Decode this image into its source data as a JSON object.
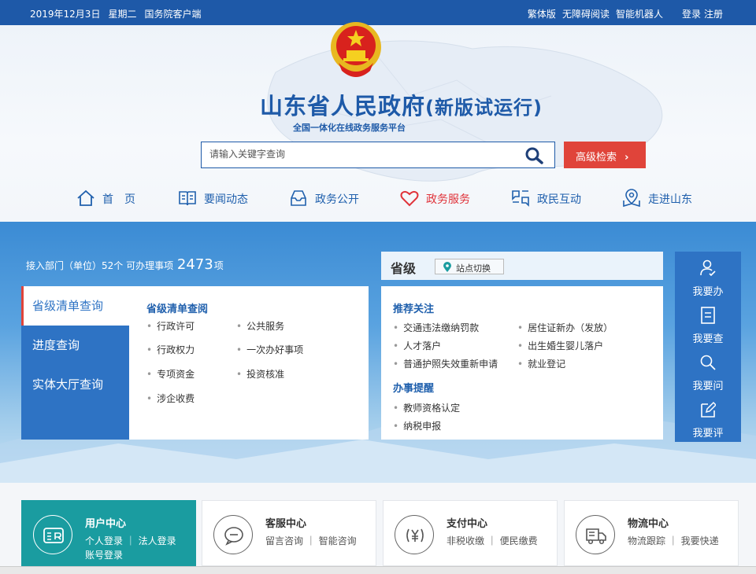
{
  "topbar": {
    "date": "2019年12月3日",
    "weekday": "星期二",
    "client": "国务院客户端",
    "traditional": "繁体版",
    "accessible": "无障碍阅读",
    "robot": "智能机器人",
    "login": "登录",
    "register": "注册"
  },
  "header": {
    "title": "山东省人民政府",
    "title_suffix": "(新版试运行)",
    "subtitle": "全国一体化在线政务服务平台",
    "search_placeholder": "请输入关键字查询",
    "advanced_search": "高级检索"
  },
  "nav": [
    {
      "label": "首　页",
      "icon": "home-icon"
    },
    {
      "label": "要闻动态",
      "icon": "book-icon"
    },
    {
      "label": "政务公开",
      "icon": "inbox-icon"
    },
    {
      "label": "政务服务",
      "icon": "heart-icon",
      "active": true
    },
    {
      "label": "政民互动",
      "icon": "chat-icon"
    },
    {
      "label": "走进山东",
      "icon": "map-pin-icon"
    }
  ],
  "stats": {
    "prefix": "接入部门（单位）52个 可办理事项",
    "number": "2473",
    "suffix": "项"
  },
  "side_menu": [
    {
      "label": "省级清单查询",
      "active": true
    },
    {
      "label": "进度查询"
    },
    {
      "label": "实体大厅查询"
    }
  ],
  "panel1": {
    "title": "省级清单查阅",
    "items": [
      "行政许可",
      "公共服务",
      "行政权力",
      "一次办好事项",
      "专项资金",
      "投资核准",
      "涉企收费"
    ]
  },
  "level": {
    "label": "省级",
    "switch": "站点切换"
  },
  "panel2": {
    "recommend_title": "推荐关注",
    "recommend": [
      "交通违法缴纳罚款",
      "居住证新办（发放）",
      "人才落户",
      "出生婚生婴儿落户",
      "普通护照失效重新申请",
      "就业登记"
    ],
    "reminder_title": "办事提醒",
    "reminders": [
      "教师资格认定",
      "纳税申报"
    ]
  },
  "quick": [
    {
      "label": "我要办",
      "icon": "user-check-icon"
    },
    {
      "label": "我要查",
      "icon": "document-icon"
    },
    {
      "label": "我要问",
      "icon": "search-icon"
    },
    {
      "label": "我要评",
      "icon": "edit-icon"
    }
  ],
  "cards": [
    {
      "title": "用户中心",
      "line1": "个人登录 ｜ 法人登录",
      "line2": "账号登录",
      "icon": "id-card-icon"
    },
    {
      "title": "客服中心",
      "line1": "留言咨询 ｜ 智能咨询",
      "icon": "chat-bubble-icon"
    },
    {
      "title": "支付中心",
      "line1": "非税收缴 ｜ 便民缴费",
      "icon": "yuan-icon"
    },
    {
      "title": "物流中心",
      "line1": "物流跟踪 ｜ 我要快递",
      "icon": "truck-icon"
    }
  ],
  "colors": {
    "primary": "#1e59a8",
    "accent": "#e0443a",
    "teal": "#1a9ca0"
  }
}
